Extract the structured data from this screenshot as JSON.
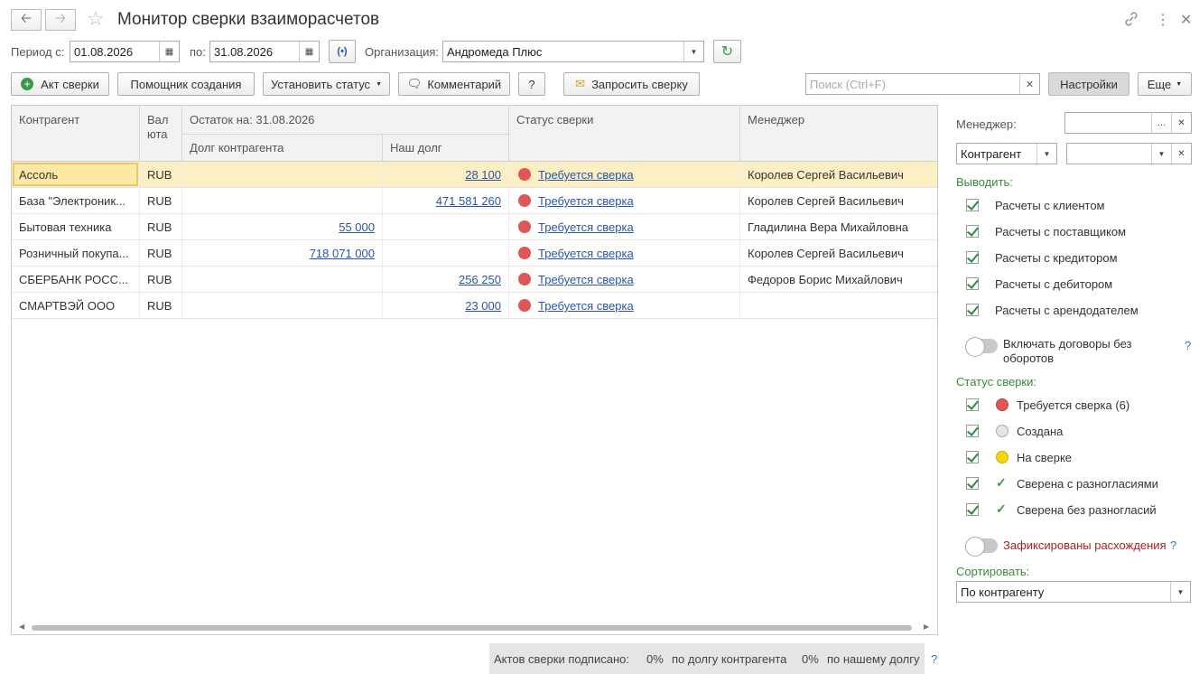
{
  "window": {
    "title": "Монитор сверки взаиморасчетов"
  },
  "filters": {
    "period_from_label": "Период с:",
    "period_from": "01.08.2026",
    "period_to_label": "по:",
    "period_to": "31.08.2026",
    "org_label": "Организация:",
    "org_value": "Андромеда Плюс"
  },
  "toolbar": {
    "act_label": "Акт сверки",
    "wizard_label": "Помощник создания",
    "set_status_label": "Установить статус",
    "comment_label": "Комментарий",
    "help_label": "?",
    "request_label": "Запросить сверку",
    "search_placeholder": "Поиск (Ctrl+F)",
    "settings_label": "Настройки",
    "more_label": "Еще"
  },
  "table": {
    "headers": {
      "counterparty": "Контрагент",
      "currency_1": "Вал",
      "currency_2": "юта",
      "balance": "Остаток на: 31.08.2026",
      "their_debt": "Долг контрагента",
      "our_debt": "Наш долг",
      "status": "Статус сверки",
      "manager": "Менеджер"
    },
    "rows": [
      {
        "counterparty": "Ассоль",
        "currency": "RUB",
        "their_debt": "",
        "our_debt": "28 100",
        "status": "Требуется сверка",
        "manager": "Королев Сергей Васильевич"
      },
      {
        "counterparty": "База \"Электроник...",
        "currency": "RUB",
        "their_debt": "",
        "our_debt": "471 581 260",
        "status": "Требуется сверка",
        "manager": "Королев Сергей Васильевич"
      },
      {
        "counterparty": "Бытовая техника",
        "currency": "RUB",
        "their_debt": "55 000",
        "our_debt": "",
        "status": "Требуется сверка",
        "manager": "Гладилина Вера Михайловна"
      },
      {
        "counterparty": "Розничный покупа...",
        "currency": "RUB",
        "their_debt": "718 071 000",
        "our_debt": "",
        "status": "Требуется сверка",
        "manager": "Королев Сергей Васильевич"
      },
      {
        "counterparty": "СБЕРБАНК РОСС...",
        "currency": "RUB",
        "their_debt": "",
        "our_debt": "256 250",
        "status": "Требуется сверка",
        "manager": "Федоров Борис Михайлович"
      },
      {
        "counterparty": "СМАРТВЭЙ ООО",
        "currency": "RUB",
        "their_debt": "",
        "our_debt": "23 000",
        "status": "Требуется сверка",
        "manager": ""
      }
    ]
  },
  "footer": {
    "signed_label": "Актов сверки подписано:",
    "their_pct": "0%",
    "their_label": "по долгу контрагента",
    "our_pct": "0%",
    "our_label": "по нашему долгу",
    "help": "?"
  },
  "panel": {
    "manager_label": "Менеджер:",
    "contractor_select": "Контрагент",
    "output_label": "Выводить:",
    "outputs": [
      "Расчеты с клиентом",
      "Расчеты с поставщиком",
      "Расчеты с кредитором",
      "Расчеты с дебитором",
      "Расчеты с арендодателем"
    ],
    "include_contracts_1": "Включать договоры без",
    "include_contracts_2": "оборотов",
    "status_label": "Статус сверки:",
    "statuses": [
      "Требуется сверка (6)",
      "Создана",
      "На сверке",
      "Сверена с разногласиями",
      "Сверена без разногласий"
    ],
    "discrepancy_label": "Зафиксированы расхождения",
    "sort_label": "Сортировать:",
    "sort_value": "По контрагенту",
    "help": "?"
  },
  "colors": {
    "status_red": "#e05555",
    "status_gray": "#e6e6e6",
    "status_yellow": "#f5d800",
    "accent_green": "#3a8a3a",
    "link_blue": "#2a55a8",
    "selection": "#fbefc3"
  }
}
